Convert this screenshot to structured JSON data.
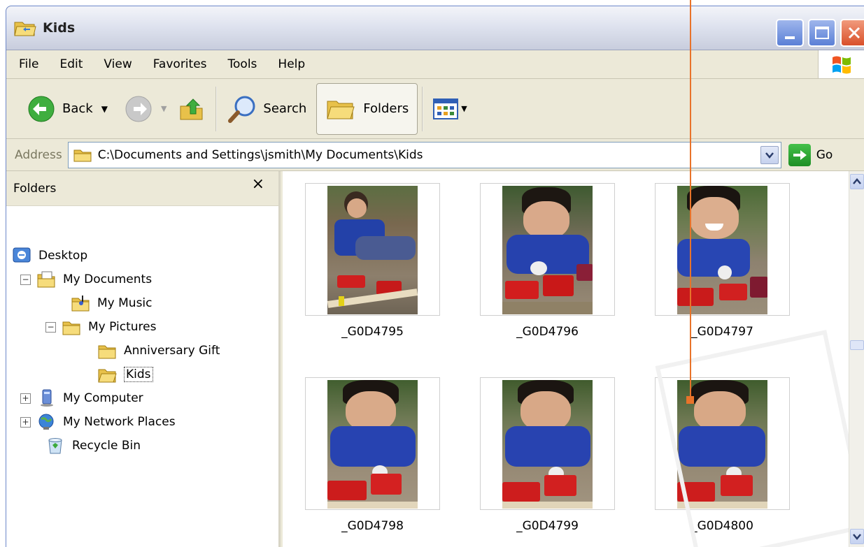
{
  "window": {
    "title": "Kids",
    "accent": "#e8732a"
  },
  "menu": [
    "File",
    "Edit",
    "View",
    "Favorites",
    "Tools",
    "Help"
  ],
  "toolbar": {
    "back_label": "Back",
    "search_label": "Search",
    "folders_label": "Folders"
  },
  "address": {
    "label": "Address",
    "path": "C:\\Documents and Settings\\jsmith\\My Documents\\Kids",
    "go_label": "Go"
  },
  "folders_pane": {
    "title": "Folders",
    "close_glyph": "×",
    "tree": [
      {
        "label": "Desktop",
        "icon": "desktop-icon"
      },
      {
        "label": "My Documents",
        "icon": "my-documents-icon",
        "expander": "−"
      },
      {
        "label": "My Music",
        "icon": "music-folder-icon"
      },
      {
        "label": "My Pictures",
        "icon": "folder-icon",
        "expander": "−"
      },
      {
        "label": "Anniversary Gift",
        "icon": "folder-icon"
      },
      {
        "label": "Kids",
        "icon": "open-folder-icon",
        "selected": true
      },
      {
        "label": "My Computer",
        "icon": "my-computer-icon",
        "expander": "+"
      },
      {
        "label": "My Network Places",
        "icon": "network-places-icon",
        "expander": "+"
      },
      {
        "label": "Recycle Bin",
        "icon": "recycle-bin-icon"
      }
    ]
  },
  "files": [
    {
      "name": "_G0D4795"
    },
    {
      "name": "_G0D4796"
    },
    {
      "name": "_G0D4797"
    },
    {
      "name": "_G0D4798"
    },
    {
      "name": "_G0D4799"
    },
    {
      "name": "_G0D4800"
    }
  ]
}
